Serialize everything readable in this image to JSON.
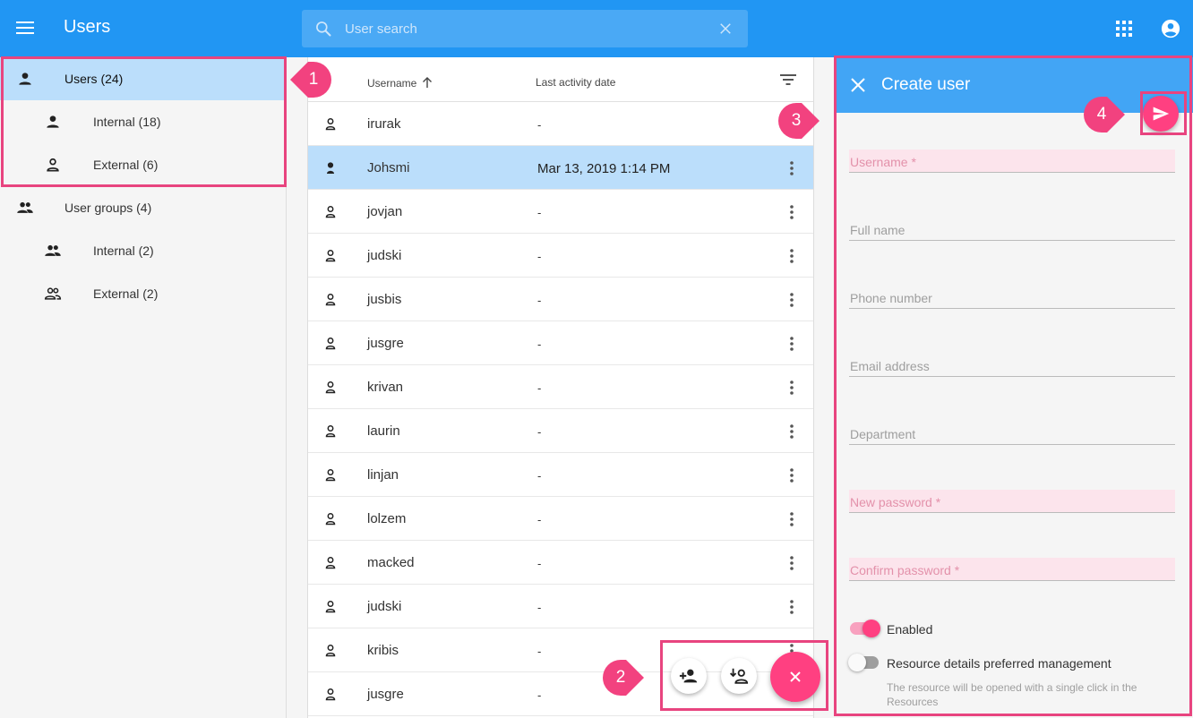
{
  "app": {
    "title": "Users"
  },
  "search": {
    "placeholder": "User search"
  },
  "sidebar": {
    "items": [
      {
        "label": "Users (24)"
      },
      {
        "label": "Internal (18)"
      },
      {
        "label": "External (6)"
      },
      {
        "label": "User groups (4)"
      },
      {
        "label": "Internal (2)"
      },
      {
        "label": "External (2)"
      }
    ]
  },
  "table": {
    "columns": {
      "username": "Username",
      "last_activity": "Last activity date"
    },
    "rows": [
      {
        "username": "irurak",
        "last_activity": "-"
      },
      {
        "username": "Johsmi",
        "last_activity": "Mar 13, 2019 1:14 PM"
      },
      {
        "username": "jovjan",
        "last_activity": "-"
      },
      {
        "username": "judski",
        "last_activity": "-"
      },
      {
        "username": "jusbis",
        "last_activity": "-"
      },
      {
        "username": "jusgre",
        "last_activity": "-"
      },
      {
        "username": "krivan",
        "last_activity": "-"
      },
      {
        "username": "laurin",
        "last_activity": "-"
      },
      {
        "username": "linjan",
        "last_activity": "-"
      },
      {
        "username": "lolzem",
        "last_activity": "-"
      },
      {
        "username": "macked",
        "last_activity": "-"
      },
      {
        "username": "judski",
        "last_activity": "-"
      },
      {
        "username": "kribis",
        "last_activity": "-"
      },
      {
        "username": "jusgre",
        "last_activity": "-"
      }
    ]
  },
  "panel": {
    "title": "Create user",
    "fields": {
      "username": "Username *",
      "full_name": "Full name",
      "phone": "Phone number",
      "email": "Email address",
      "department": "Department",
      "new_password": "New password *",
      "confirm_password": "Confirm password *"
    },
    "enabled_label": "Enabled",
    "resource_label": "Resource details preferred management",
    "resource_hint": "The resource will be opened with a single click in the Resources"
  },
  "callouts": [
    "1",
    "2",
    "3",
    "4"
  ],
  "colors": {
    "header": "#2196f3",
    "panel_header": "#42a5f5",
    "accent": "#ff4081",
    "highlight": "#e8447f",
    "selected_row": "#bbdefb"
  }
}
